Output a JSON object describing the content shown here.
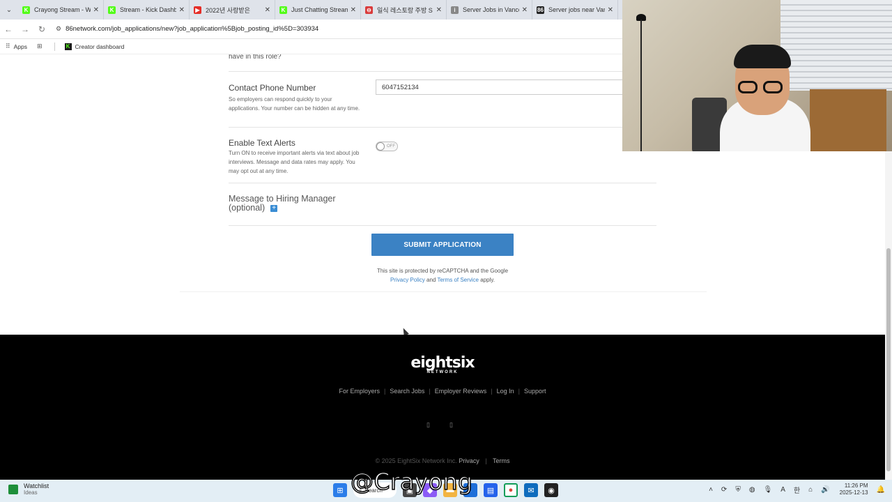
{
  "tabs": [
    {
      "title": "Crayong Stream - Wa",
      "fav_color": "#53fc18",
      "fav_glyph": "K"
    },
    {
      "title": "Stream - Kick Dashbo",
      "fav_color": "#53fc18",
      "fav_glyph": "K"
    },
    {
      "title": "2022년 사랑받은",
      "fav_color": "#e52d27",
      "fav_glyph": "▶"
    },
    {
      "title": "Just Chatting Stream",
      "fav_color": "#53fc18",
      "fav_glyph": "K"
    },
    {
      "title": "일식 레스토랑 주방 S",
      "fav_color": "#d93b3b",
      "fav_glyph": "⊖"
    },
    {
      "title": "Server Jobs in Vanco",
      "fav_color": "#888888",
      "fav_glyph": "i"
    },
    {
      "title": "Server jobs near Vanc",
      "fav_color": "#222222",
      "fav_glyph": "86"
    }
  ],
  "address": {
    "url": "86network.com/job_applications/new?job_application%5Bjob_posting_id%5D=303934"
  },
  "bookmarks": {
    "apps": "Apps",
    "creator": "Creator dashboard"
  },
  "form": {
    "cut_text": "have in this role?",
    "phone": {
      "label": "Contact Phone Number",
      "help": "So employers can respond quickly to your applications. Your number can be hidden at any time.",
      "value": "6047152134"
    },
    "alerts": {
      "label": "Enable Text Alerts",
      "help": "Turn ON to receive important alerts via text about job interviews. Message and data rates may apply. You may opt out at any time.",
      "state": "OFF"
    },
    "message": {
      "label_line1": "Message to Hiring Manager",
      "label_line2": "(optional)"
    },
    "submit_label": "SUBMIT APPLICATION",
    "recaptcha": {
      "line1": "This site is protected by reCAPTCHA and the Google",
      "privacy": "Privacy Policy",
      "and": "and",
      "terms": "Terms of Service",
      "apply": "apply."
    }
  },
  "footer": {
    "logo_main": "eightsix",
    "logo_sub": "NETWORK",
    "links": [
      "For Employers",
      "Search Jobs",
      "Employer Reviews",
      "Log In",
      "Support"
    ],
    "copyright": "© 2025 EightSix Network Inc.",
    "privacy": "Privacy",
    "terms": "Terms"
  },
  "taskbar": {
    "watchlist": "Watchlist",
    "watch_sub": "Ideas",
    "search": "Search",
    "time": "11:26 PM",
    "date": "2025-12-13"
  },
  "watermark": "@Crayong",
  "colors": {
    "accent": "#3b82c4",
    "footer_bg": "#000000"
  }
}
